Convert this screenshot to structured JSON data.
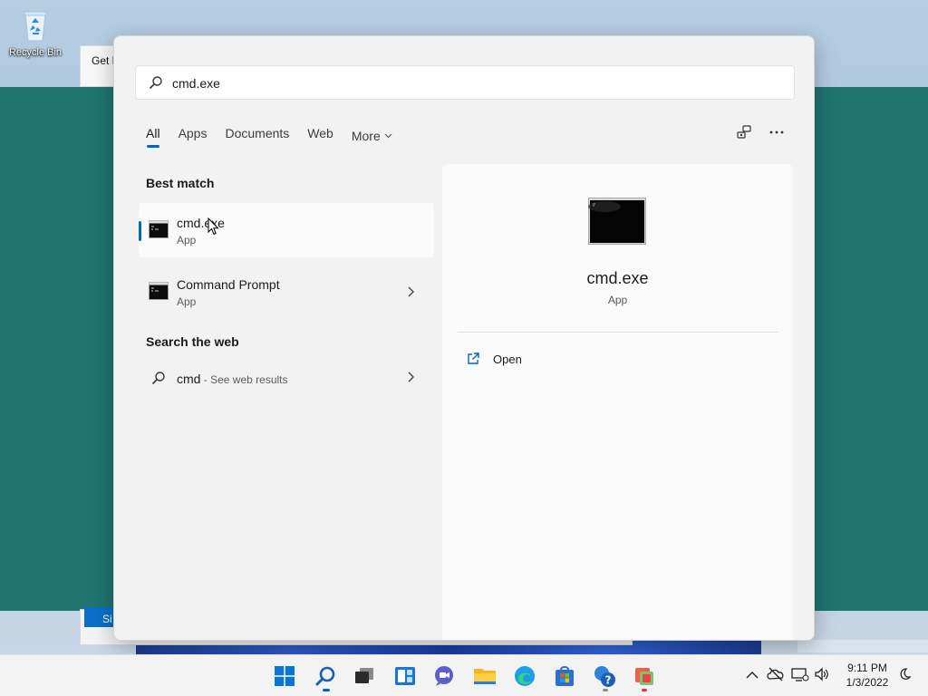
{
  "desktop": {
    "recycle_bin_label": "Recycle Bin",
    "background_window_tab": "Get H",
    "background_button": "Si"
  },
  "search": {
    "query": "cmd.exe",
    "tabs": [
      {
        "label": "All",
        "active": true
      },
      {
        "label": "Apps"
      },
      {
        "label": "Documents"
      },
      {
        "label": "Web"
      },
      {
        "label": "More"
      }
    ],
    "icons": {
      "share": "share-icon",
      "more": "more-options-icon"
    }
  },
  "results": {
    "best_match_title": "Best match",
    "best_match": {
      "title": "cmd.exe",
      "subtitle": "App"
    },
    "second": {
      "title": "Command Prompt",
      "subtitle": "App"
    },
    "web_title": "Search the web",
    "web": {
      "query": "cmd",
      "suffix": " - See web results"
    }
  },
  "detail": {
    "title": "cmd.exe",
    "subtitle": "App",
    "actions": [
      {
        "label": "Open",
        "icon": "open-external-icon"
      }
    ]
  },
  "taskbar": {
    "icons": [
      "start-icon",
      "search-icon",
      "task-view-icon",
      "widgets-icon",
      "chat-icon",
      "file-explorer-icon",
      "edge-icon",
      "store-icon",
      "get-help-icon",
      "app-icon"
    ],
    "clock": {
      "time": "9:11 PM",
      "date": "1/3/2022"
    }
  },
  "colors": {
    "accent": "#0067c0",
    "flyout_bg": "#f2f2f2",
    "desktop_window": "#1f7470"
  }
}
